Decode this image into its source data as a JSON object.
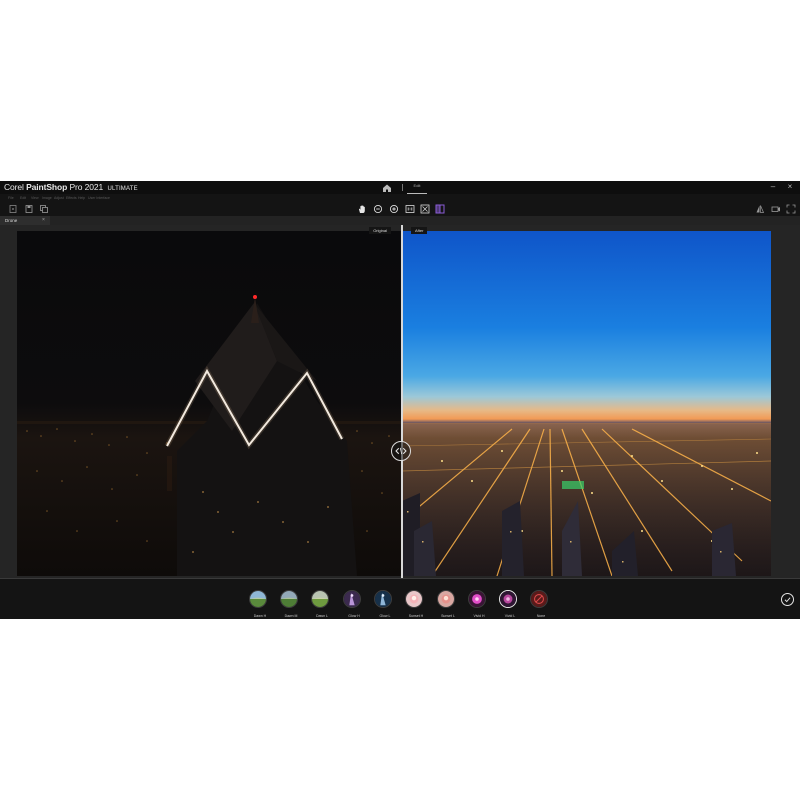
{
  "window": {
    "title_brand": "Corel",
    "title_app": "PaintShop",
    "title_pro": "Pro 2021",
    "title_edition": "ULTIMATE",
    "edit_tab": "Edit"
  },
  "menu": {
    "items": [
      "File",
      "Edit",
      "View",
      "Image",
      "Adjust",
      "Effects",
      "Help",
      "User Interface"
    ]
  },
  "toolbar": {
    "left_icons": [
      "new-file-icon",
      "save-icon",
      "copy-icon"
    ],
    "center_icons": [
      "pan-hand-icon",
      "zoom-out-icon",
      "zoom-in-icon",
      "actual-size-icon",
      "fit-window-icon",
      "compare-view-icon"
    ],
    "right_icons": [
      "flip-icon",
      "camera-icon",
      "fullscreen-icon"
    ]
  },
  "document": {
    "tab_label": "Drone"
  },
  "compare": {
    "original_label": "Original",
    "after_label": "After"
  },
  "presets": [
    {
      "name": "Dawn H"
    },
    {
      "name": "Dawn M"
    },
    {
      "name": "Dawn L"
    },
    {
      "name": "Glow H"
    },
    {
      "name": "Glow L"
    },
    {
      "name": "Sunset H"
    },
    {
      "name": "Sunset L"
    },
    {
      "name": "Vivid H"
    },
    {
      "name": "Vivid L"
    },
    {
      "name": "None"
    }
  ],
  "colors": {
    "app_bg": "#1e1e1e",
    "accent": "#4aa3df",
    "compare_icon": "#8a5cd6",
    "night_sky": "#0b0b0e",
    "dusk_blue": "#1a7fe0"
  }
}
